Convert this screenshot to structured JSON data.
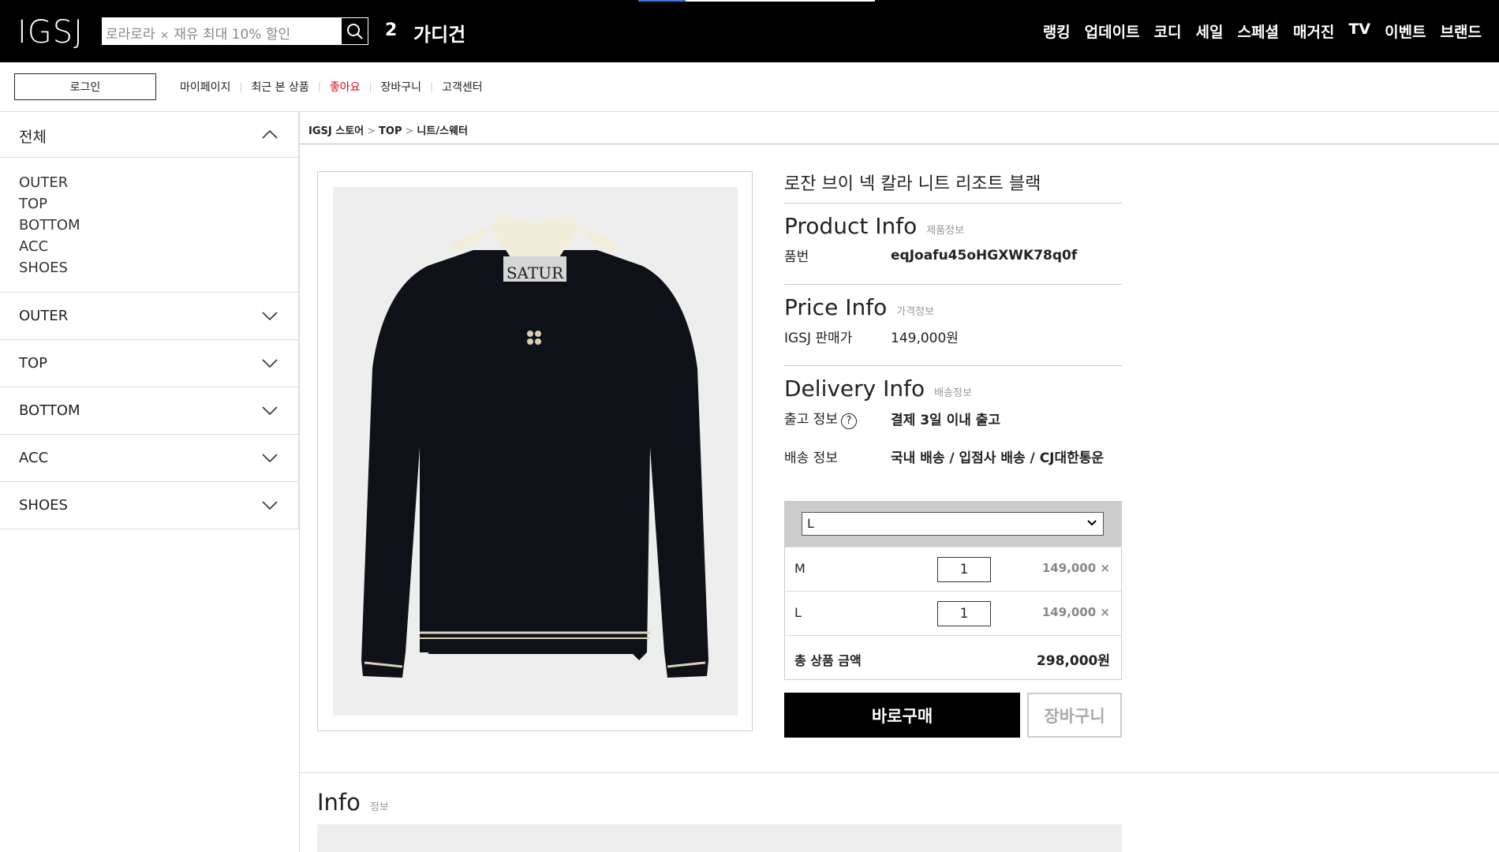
{
  "header": {
    "logo": "IGSJ",
    "search_placeholder": "로라로라",
    "search_clear": "×",
    "search_promo": "재유 최대 10% 할인",
    "cart_count": "2",
    "category_title": "가디건",
    "nav": [
      "랭킹",
      "업데이트",
      "코디",
      "세일",
      "스페셜",
      "매거진",
      "TV",
      "이벤트",
      "브랜드"
    ]
  },
  "utility": {
    "login": "로그인",
    "links": [
      "마이페이지",
      "최근 본 상품",
      "좋아요",
      "장바구니",
      "고객센터"
    ]
  },
  "sidebar": {
    "head": "전체",
    "list": [
      "OUTER",
      "TOP",
      "BOTTOM",
      "ACC",
      "SHOES"
    ],
    "rows": [
      "OUTER",
      "TOP",
      "BOTTOM",
      "ACC",
      "SHOES"
    ]
  },
  "breadcrumb": [
    "IGSJ 스토어",
    "TOP",
    "니트/스웨터"
  ],
  "product": {
    "title": "로잔 브이 넥 칼라 니트 리조트 블랙",
    "product_info": {
      "heading": "Product Info",
      "sub": "제품정보",
      "label": "품번",
      "value": "eqJoafu45oHGXWK78q0f"
    },
    "price_info": {
      "heading": "Price Info",
      "sub": "가격정보",
      "label": "IGSJ 판매가",
      "value": "149,000원"
    },
    "delivery_info": {
      "heading": "Delivery Info",
      "sub": "배송정보",
      "ship_label": "출고 정보",
      "help": "?",
      "ship_value": "결제 3일 이내 출고",
      "delivery_label": "배송 정보",
      "delivery_value": "국내 배송 / 입점사 배송 / CJ대한통운"
    },
    "image_brand_text": "SATUR"
  },
  "options": {
    "selected": "L",
    "items": [
      {
        "name": "M",
        "qty": "1",
        "price": "149,000",
        "remove": "×"
      },
      {
        "name": "L",
        "qty": "1",
        "price": "149,000",
        "remove": "×"
      }
    ],
    "total_label": "총 상품 금액",
    "total_value": "298,000원"
  },
  "buttons": {
    "buy": "바로구매",
    "cart": "장바구니"
  },
  "info": {
    "title": "Info",
    "sub": "정보"
  },
  "colors": {
    "topbar": "#000000",
    "like": "#e0001b",
    "load": "#3a7bd5"
  }
}
